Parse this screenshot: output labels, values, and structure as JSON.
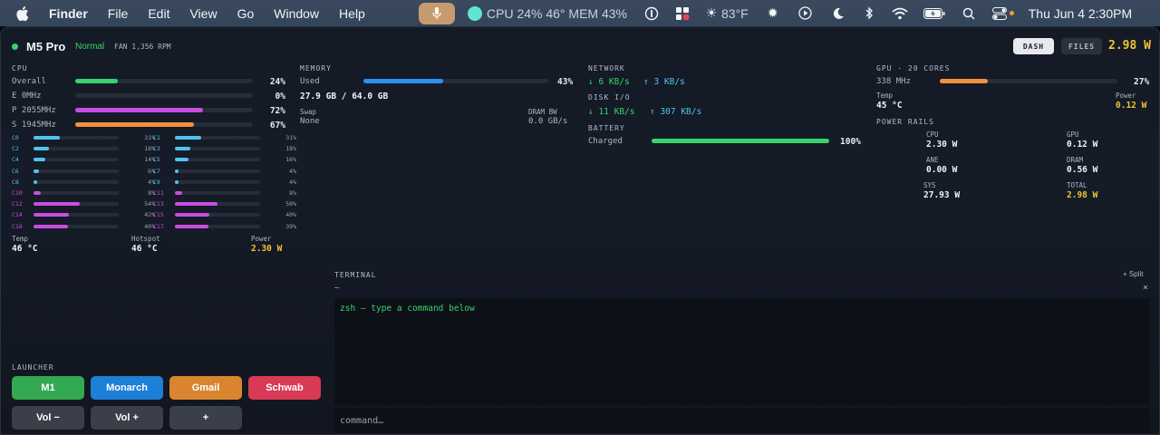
{
  "menubar": {
    "app": "Finder",
    "items": [
      "File",
      "Edit",
      "View",
      "Go",
      "Window",
      "Help"
    ],
    "stats": "CPU 24% 46° MEM 43%",
    "weather": "83°F",
    "time": "Thu Jun 4  2:30PM"
  },
  "header": {
    "title": "M5 Pro",
    "status": "Normal",
    "fan": "FAN 1,356 RPM",
    "tabs": [
      "DASH",
      "FILES"
    ],
    "power": "2.98 W"
  },
  "cpu": {
    "title": "CPU",
    "rows": [
      {
        "label": "Overall",
        "pct": "24%",
        "value": 0.24,
        "color": "#38d36b"
      },
      {
        "label": "E 0MHz",
        "pct": "0%",
        "value": 0.0,
        "color": "#4fc4f0"
      },
      {
        "label": "P 2055MHz",
        "pct": "72%",
        "value": 0.72,
        "color": "#c94ee0"
      },
      {
        "label": "S 1945MHz",
        "pct": "67%",
        "value": 0.67,
        "color": "#f5903c"
      }
    ],
    "cores": [
      {
        "label": "C0",
        "pct": "31%",
        "value": 0.31
      },
      {
        "label": "C1",
        "pct": "31%",
        "value": 0.31
      },
      {
        "label": "C2",
        "pct": "18%",
        "value": 0.18
      },
      {
        "label": "C3",
        "pct": "18%",
        "value": 0.18
      },
      {
        "label": "C4",
        "pct": "14%",
        "value": 0.14
      },
      {
        "label": "C5",
        "pct": "16%",
        "value": 0.16
      },
      {
        "label": "C6",
        "pct": "6%",
        "value": 0.06
      },
      {
        "label": "C7",
        "pct": "4%",
        "value": 0.04
      },
      {
        "label": "C8",
        "pct": "4%",
        "value": 0.04
      },
      {
        "label": "C9",
        "pct": "4%",
        "value": 0.04
      },
      {
        "label": "C10",
        "pct": "8%",
        "value": 0.08
      },
      {
        "label": "C11",
        "pct": "8%",
        "value": 0.08
      },
      {
        "label": "C12",
        "pct": "54%",
        "value": 0.54
      },
      {
        "label": "C13",
        "pct": "50%",
        "value": 0.5
      },
      {
        "label": "C14",
        "pct": "42%",
        "value": 0.42
      },
      {
        "label": "C15",
        "pct": "40%",
        "value": 0.4
      },
      {
        "label": "C16",
        "pct": "40%",
        "value": 0.4
      },
      {
        "label": "C17",
        "pct": "39%",
        "value": 0.39
      }
    ],
    "e_core_color": "#4fc4f0",
    "p_core_color": "#c94ee0",
    "temp_label": "Temp",
    "temp": "46 °C",
    "hotspot_label": "Hotspot",
    "hotspot": "46 °C",
    "power_label": "Power",
    "power": "2.30 W"
  },
  "memory": {
    "title": "MEMORY",
    "used_label": "Used",
    "used_pct": "43%",
    "used_value": 0.43,
    "used_detail": "27.9 GB / 64.0 GB",
    "swap_label": "Swap",
    "swap": "None",
    "dram_label": "DRAM BW",
    "dram": "0.0 GB/s"
  },
  "network": {
    "title": "NETWORK",
    "down": "↓ 6 KB/s",
    "up": "↑ 3 KB/s",
    "disk_title": "DISK I/O",
    "disk_read": "↓ 11 KB/s",
    "disk_write": "↑ 307 KB/s",
    "battery_title": "BATTERY",
    "battery_label": "Charged",
    "battery_pct": "100%",
    "battery_value": 1.0
  },
  "gpu": {
    "title": "GPU · 20 CORES",
    "freq": "338 MHz",
    "pct": "27%",
    "value": 0.27,
    "temp_label": "Temp",
    "temp": "45 °C",
    "power_label": "Power",
    "power": "0.12 W",
    "rails_title": "POWER RAILS",
    "rails": [
      {
        "label": "CPU",
        "value": "2.30 W"
      },
      {
        "label": "GPU",
        "value": "0.12 W"
      },
      {
        "label": "ANE",
        "value": "0.00 W"
      },
      {
        "label": "DRAM",
        "value": "0.56 W"
      },
      {
        "label": "SYS",
        "value": "27.93 W"
      },
      {
        "label": "TOTAL",
        "value": "2.98 W"
      }
    ]
  },
  "launcher": {
    "title": "LAUNCHER",
    "buttons": [
      {
        "label": "M1",
        "color": "#35a852"
      },
      {
        "label": "Monarch",
        "color": "#1e7fd6"
      },
      {
        "label": "Gmail",
        "color": "#d98530"
      },
      {
        "label": "Schwab",
        "color": "#d83a55"
      },
      {
        "label": "Vol −",
        "color": "#3a3f49"
      },
      {
        "label": "Vol +",
        "color": "#3a3f49"
      },
      {
        "label": "+",
        "color": "#3a3f49"
      }
    ]
  },
  "terminal": {
    "title": "TERMINAL",
    "split": "+ Split",
    "minimize": "–",
    "close": "×",
    "output": "zsh — type a command below",
    "placeholder": "command…"
  }
}
